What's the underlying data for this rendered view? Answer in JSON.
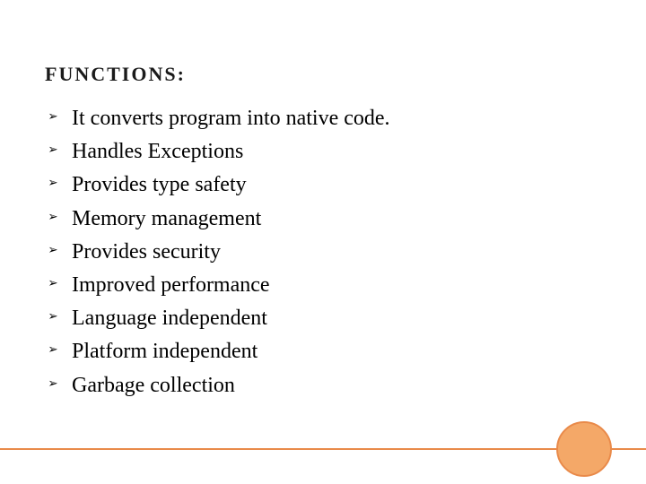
{
  "heading": "FUNCTIONS:",
  "bullet_marker": "➢",
  "items": [
    "It converts program into native code.",
    "Handles Exceptions",
    "Provides type safety",
    "Memory management",
    "Provides security",
    "Improved performance",
    "Language independent",
    "Platform independent",
    "Garbage collection"
  ],
  "accent_color": "#e98a4a"
}
